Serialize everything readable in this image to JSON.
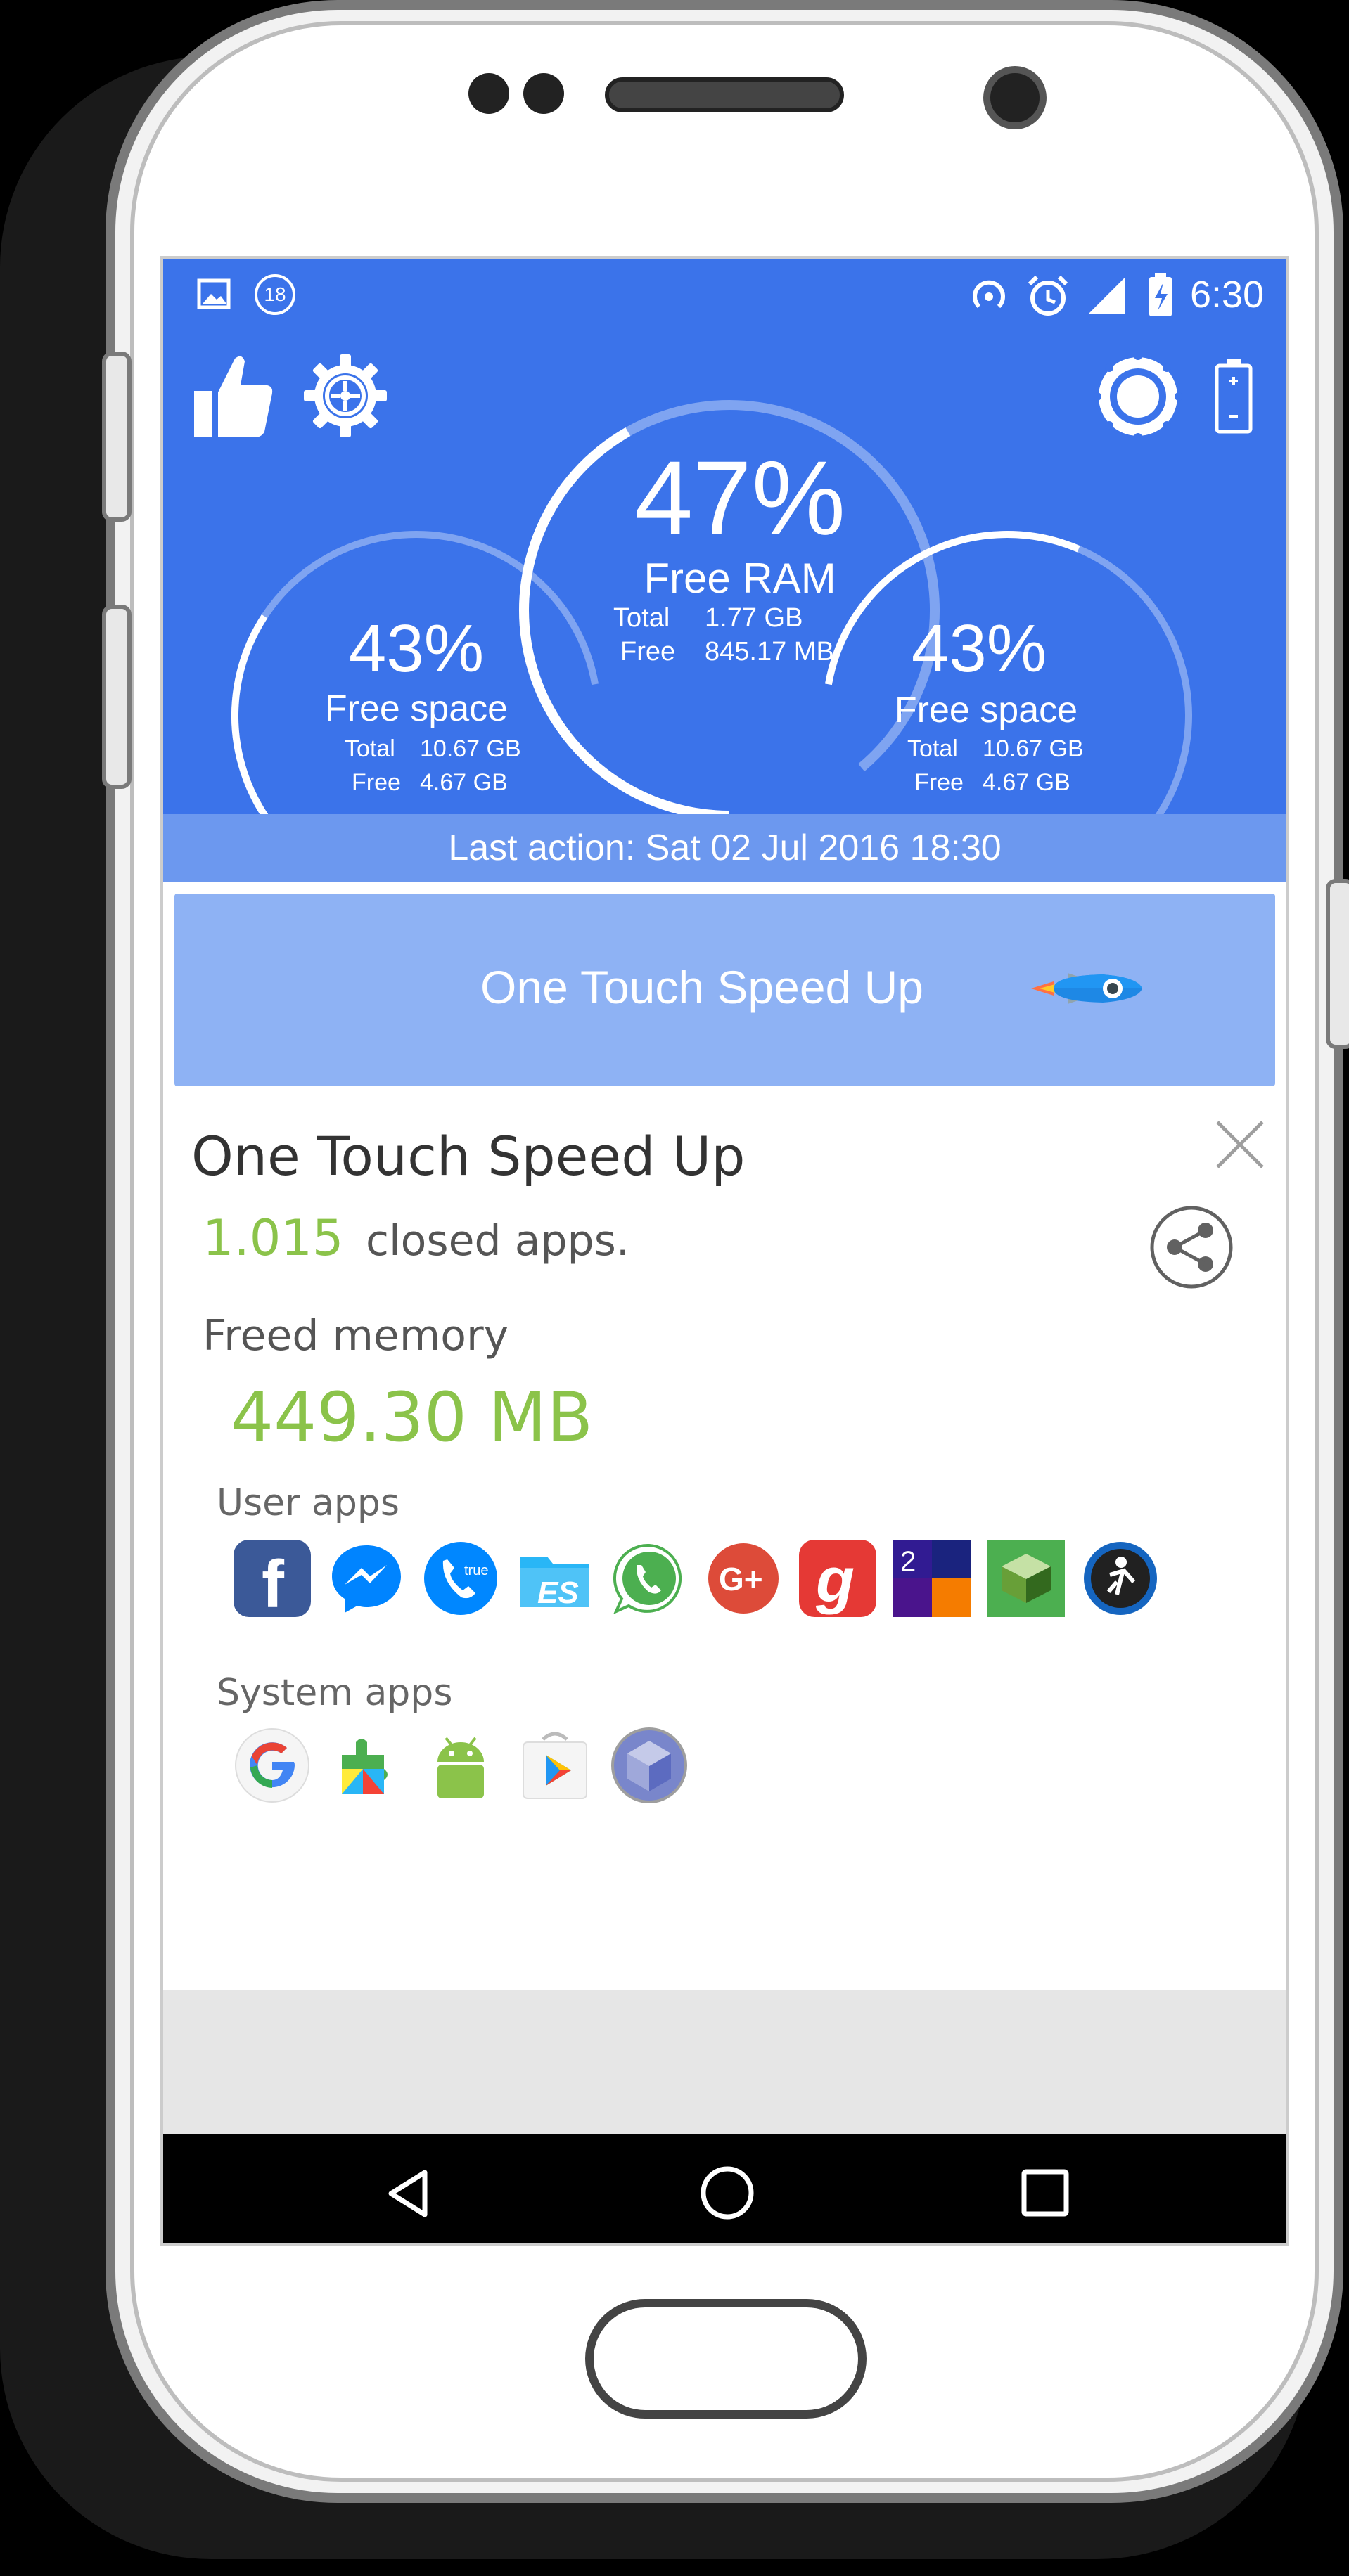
{
  "status_bar": {
    "notif_count": "18",
    "time": "6:30"
  },
  "gauges": {
    "ram": {
      "percent": "47%",
      "label": "Free RAM",
      "total_label": "Total",
      "total_value": "1.77 GB",
      "free_label": "Free",
      "free_value": "845.17 MB",
      "fraction": 0.47
    },
    "left_space": {
      "percent": "43%",
      "label": "Free space",
      "total_label": "Total",
      "total_value": "10.67 GB",
      "free_label": "Free",
      "free_value": "4.67 GB",
      "fraction": 0.43
    },
    "right_space": {
      "percent": "43%",
      "label": "Free space",
      "total_label": "Total",
      "total_value": "10.67 GB",
      "free_label": "Free",
      "free_value": "4.67 GB",
      "fraction": 0.43
    }
  },
  "last_action": {
    "label": "Last action:",
    "value": "Sat 02 Jul 2016 18:30"
  },
  "speed_button": {
    "label": "One Touch Speed Up"
  },
  "result": {
    "title": "One Touch Speed Up",
    "closed_count": "1.015",
    "closed_label": "closed apps.",
    "freed_label": "Freed memory",
    "freed_value": "449.30 MB",
    "user_apps_label": "User apps",
    "system_apps_label": "System apps",
    "user_apps": [
      "facebook-icon",
      "messenger-icon",
      "truecaller-icon",
      "es-file-explorer-icon",
      "whatsapp-icon",
      "google-plus-icon",
      "gaana-icon",
      "game-2048-icon",
      "stack-icon",
      "judo-icon"
    ],
    "system_apps": [
      "google-icon",
      "play-services-icon",
      "android-icon",
      "play-store-icon",
      "cube-icon"
    ]
  },
  "colors": {
    "header_blue": "#3b73ea",
    "accent_green": "#8bc34a",
    "button_blue": "#8eb2f4"
  }
}
